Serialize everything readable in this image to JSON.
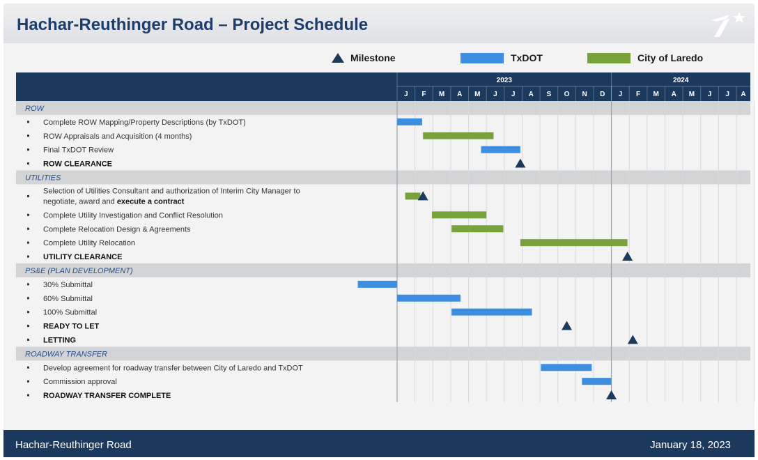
{
  "header": {
    "title": "Hachar-Reuthinger Road – Project Schedule"
  },
  "legend": [
    {
      "label": "Milestone",
      "kind": "milestone",
      "color": "#1c3a5e"
    },
    {
      "label": "TxDOT",
      "kind": "bar",
      "color": "#3d8ee0"
    },
    {
      "label": "City of Laredo",
      "kind": "bar",
      "color": "#77a23c"
    }
  ],
  "footer": {
    "left": "Hachar-Reuthinger Road",
    "right": "January 18, 2023"
  },
  "colors": {
    "header_bg": "#1c3a5e",
    "txdot": "#3d8ee0",
    "city": "#77a23c",
    "milestone": "#1c3a5e",
    "section_bg": "#d3d4d6",
    "title": "#1f3d6b"
  },
  "chart_data": {
    "type": "gantt",
    "title": "Hachar-Reuthinger Road – Project Schedule",
    "timeline_start": "2023-01",
    "years": [
      {
        "label": "2023",
        "months": 12
      },
      {
        "label": "2024",
        "months": 7
      }
    ],
    "months": [
      "J",
      "F",
      "M",
      "A",
      "M",
      "J",
      "J",
      "A",
      "S",
      "O",
      "N",
      "D",
      "J",
      "F",
      "M",
      "A",
      "M",
      "J",
      "J",
      "A"
    ],
    "rows": [
      {
        "type": "section",
        "label": "ROW"
      },
      {
        "type": "task",
        "label": "Complete ROW Mapping/Property Descriptions (by TxDOT)",
        "bars": [
          {
            "owner": "txdot",
            "start": 0.0,
            "end": 1.4
          }
        ]
      },
      {
        "type": "task",
        "label": "ROW Appraisals and Acquisition (4 months)",
        "bars": [
          {
            "owner": "city",
            "start": 1.45,
            "end": 5.4
          }
        ]
      },
      {
        "type": "task",
        "label": "Final TxDOT Review",
        "bars": [
          {
            "owner": "txdot",
            "start": 4.7,
            "end": 6.9
          }
        ]
      },
      {
        "type": "task",
        "label": "ROW CLEARANCE",
        "bold": true,
        "milestones": [
          6.9
        ]
      },
      {
        "type": "section",
        "label": "UTILITIES"
      },
      {
        "type": "task",
        "label": "Selection of Utilities Consultant and authorization of Interim City Manager to",
        "label2_prefix": "negotiate, award and ",
        "label2_bold": "execute a contract",
        "double": true,
        "bars": [
          {
            "owner": "city",
            "start": 0.45,
            "end": 1.3
          }
        ],
        "milestones": [
          1.45
        ]
      },
      {
        "type": "task",
        "label": "Complete Utility Investigation and Conflict Resolution",
        "bars": [
          {
            "owner": "city",
            "start": 1.95,
            "end": 5.0
          }
        ]
      },
      {
        "type": "task",
        "label": "Complete Relocation Design & Agreements",
        "bars": [
          {
            "owner": "city",
            "start": 3.05,
            "end": 5.95
          }
        ]
      },
      {
        "type": "task",
        "label": "Complete Utility Relocation",
        "bars": [
          {
            "owner": "city",
            "start": 6.9,
            "end": 12.9
          }
        ]
      },
      {
        "type": "task",
        "label": "UTILITY CLEARANCE",
        "bold": true,
        "milestones": [
          12.9
        ]
      },
      {
        "type": "section",
        "label": "PS&E (PLAN DEVELOPMENT)"
      },
      {
        "type": "task",
        "label": "30% Submittal",
        "bars": [
          {
            "owner": "txdot",
            "start": -2.2,
            "end": 0.0
          }
        ]
      },
      {
        "type": "task",
        "label": "60% Submittal",
        "bars": [
          {
            "owner": "txdot",
            "start": 0.0,
            "end": 3.55
          }
        ]
      },
      {
        "type": "task",
        "label": "100% Submittal",
        "bars": [
          {
            "owner": "txdot",
            "start": 3.05,
            "end": 7.55
          }
        ]
      },
      {
        "type": "task",
        "label": "READY TO LET",
        "bold": true,
        "milestones": [
          9.5
        ]
      },
      {
        "type": "task",
        "label": "LETTING",
        "bold": true,
        "milestones": [
          13.2
        ]
      },
      {
        "type": "section",
        "label": "ROADWAY TRANSFER"
      },
      {
        "type": "task",
        "label": "Develop agreement for roadway transfer between City of Laredo and TxDOT",
        "bars": [
          {
            "owner": "txdot",
            "start": 8.05,
            "end": 10.9
          }
        ]
      },
      {
        "type": "task",
        "label": "Commission approval",
        "bars": [
          {
            "owner": "txdot",
            "start": 10.35,
            "end": 12.0
          }
        ]
      },
      {
        "type": "task",
        "label": "ROADWAY TRANSFER COMPLETE",
        "bold": true,
        "milestones": [
          12.0
        ]
      }
    ]
  }
}
